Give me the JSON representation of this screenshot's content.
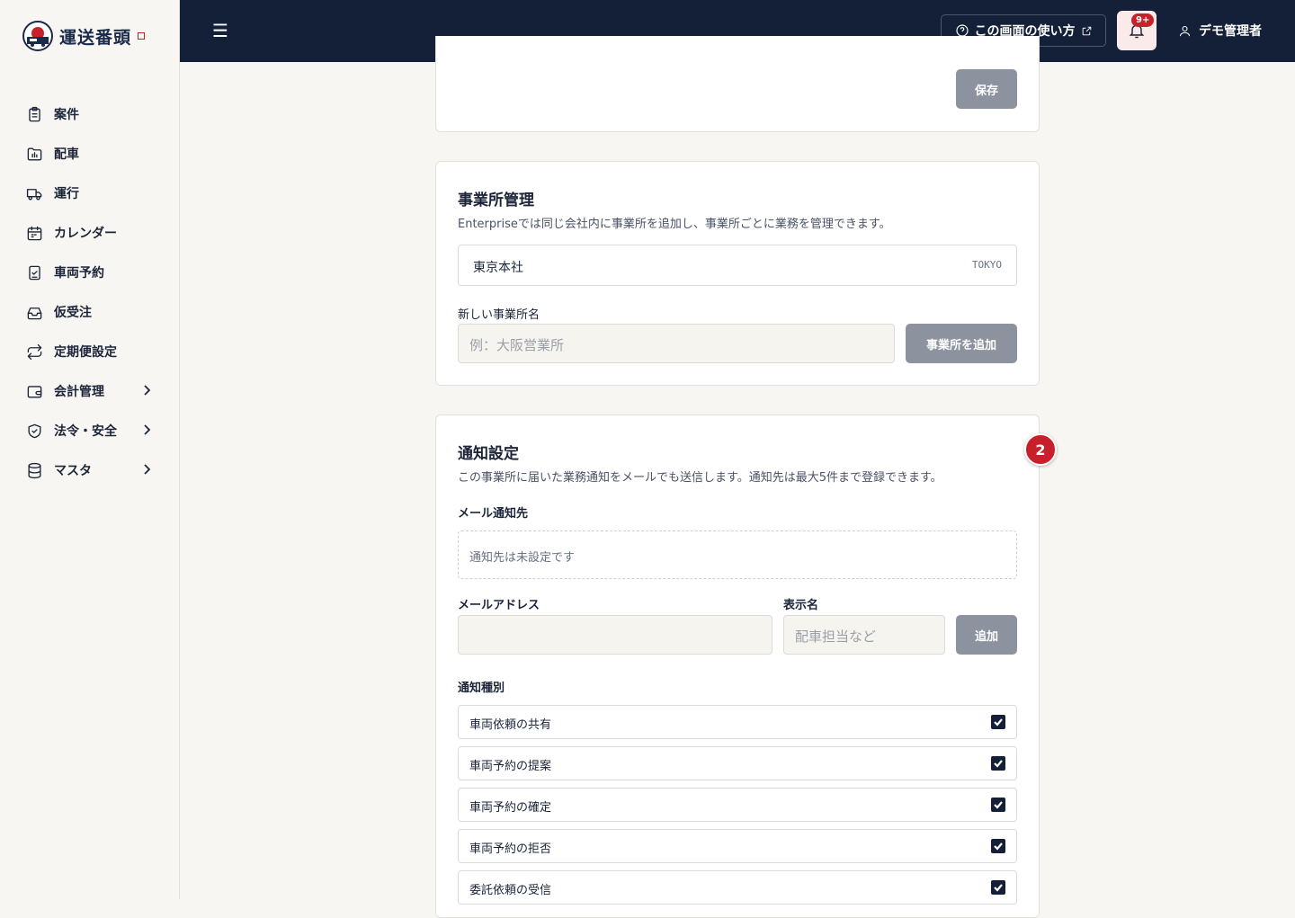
{
  "app": {
    "logo_text": "運送番頭"
  },
  "sidebar": {
    "items": [
      {
        "label": "案件",
        "icon": "clipboard-icon"
      },
      {
        "label": "配車",
        "icon": "folder-chart-icon"
      },
      {
        "label": "運行",
        "icon": "truck-icon"
      },
      {
        "label": "カレンダー",
        "icon": "calendar-icon"
      },
      {
        "label": "車両予約",
        "icon": "clipboard-check-icon"
      },
      {
        "label": "仮受注",
        "icon": "inbox-icon"
      },
      {
        "label": "定期便設定",
        "icon": "repeat-icon"
      },
      {
        "label": "会計管理",
        "icon": "wallet-icon"
      },
      {
        "label": "法令・安全",
        "icon": "shield-check-icon"
      },
      {
        "label": "マスタ",
        "icon": "database-icon"
      }
    ]
  },
  "header": {
    "help_label": "この画面の使い方",
    "notification_badge": "9+",
    "user_name": "デモ管理者"
  },
  "top_card": {
    "save_label": "保存"
  },
  "office": {
    "title": "事業所管理",
    "description": "Enterpriseでは同じ会社内に事業所を追加し、事業所ごとに業務を管理できます。",
    "existing": {
      "name": "東京本社",
      "code": "TOKYO"
    },
    "new_label": "新しい事業所名",
    "new_placeholder": "例：大阪営業所",
    "add_label": "事業所を追加"
  },
  "notify": {
    "step": "2",
    "title": "通知設定",
    "description": "この事業所に届いた業務通知をメールでも送信します。通知先は最大5件まで登録できます。",
    "recipients_label": "メール通知先",
    "empty_text": "通知先は未設定です",
    "email_label": "メールアドレス",
    "email_value": "",
    "display_label": "表示名",
    "display_placeholder": "配車担当など",
    "add_label": "追加",
    "types_label": "通知種別",
    "types": [
      {
        "label": "車両依頼の共有",
        "checked": true
      },
      {
        "label": "車両予約の提案",
        "checked": true
      },
      {
        "label": "車両予約の確定",
        "checked": true
      },
      {
        "label": "車両予約の拒否",
        "checked": true
      },
      {
        "label": "委託依頼の受信",
        "checked": true
      }
    ]
  },
  "colors": {
    "navy": "#142037",
    "accent_red": "#c8202a",
    "button_gray": "#8c939f"
  }
}
